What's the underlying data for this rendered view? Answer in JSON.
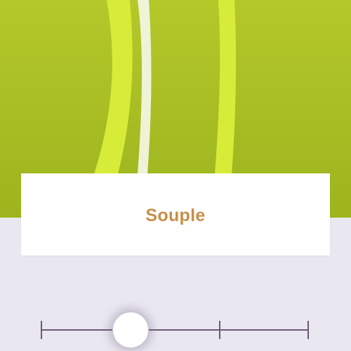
{
  "hero": {
    "image": "lime-green-painted-stripes-texture",
    "colors": {
      "background": "#a7bf22",
      "stripe": "#dcef3c",
      "white_line": "#f4f6e6"
    }
  },
  "card": {
    "title": "Souple",
    "title_color": "#c88f48"
  },
  "slider": {
    "stops": 4,
    "selected_index": 1,
    "track_color": "#6b5a75"
  },
  "background_color": "#e9e7f0"
}
